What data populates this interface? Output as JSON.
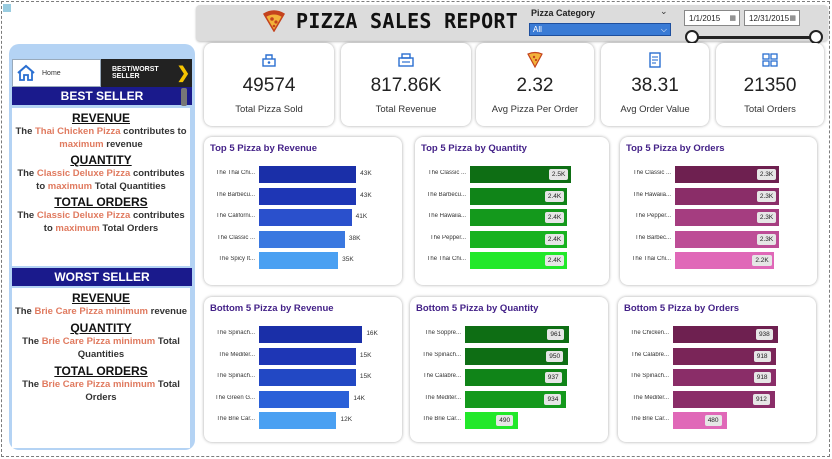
{
  "header": {
    "title": "PIZZA SALES REPORT",
    "slicer_label": "Pizza Category",
    "slicer_value": "All",
    "date_start": "1/1/2015",
    "date_end": "12/31/2015"
  },
  "nav": {
    "home_label": "Home",
    "best_worst_label": "BEST/WORST SELLER"
  },
  "best": {
    "heading": "BEST SELLER",
    "revenue": {
      "title": "REVENUE",
      "pre": "The ",
      "name": "Thai Chicken Pizza",
      "mid": " contributes to ",
      "max": "maximum",
      "post": " revenue"
    },
    "quantity": {
      "title": "QUANTITY",
      "pre": "The ",
      "name": "Classic Deluxe  Pizza",
      "mid": " contributes to ",
      "max": "maximum",
      "post": " Total Quantities"
    },
    "orders": {
      "title": "TOTAL ORDERS",
      "pre": "The ",
      "name": "Classic Deluxe  Pizza",
      "mid": " contributes to ",
      "max": "maximum",
      "post": " Total Orders"
    }
  },
  "worst": {
    "heading": "WORST SELLER",
    "revenue": {
      "title": "REVENUE",
      "pre": "The ",
      "name": "Brie Care Pizza minimum",
      "post": " revenue"
    },
    "quantity": {
      "title": "QUANTITY",
      "pre": "The ",
      "name": "Brie Care Pizza minimum",
      "post": " Total Quantities"
    },
    "orders": {
      "title": "TOTAL ORDERS",
      "pre": "The ",
      "name": "Brie Care  Pizza minimum",
      "post": " Total Orders"
    }
  },
  "kpis": [
    {
      "value": "49574",
      "label": "Total Pizza Sold",
      "icon": "takeaway-icon"
    },
    {
      "value": "817.86K",
      "label": "Total Revenue",
      "icon": "cash-register-icon"
    },
    {
      "value": "2.32",
      "label": "Avg Pizza Per Order",
      "icon": "pizza-slice-icon"
    },
    {
      "value": "38.31",
      "label": "Avg Order Value",
      "icon": "receipt-icon"
    },
    {
      "value": "21350",
      "label": "Total Orders",
      "icon": "orders-icon"
    }
  ],
  "chart_data": [
    {
      "type": "bar",
      "title": "Top 5 Pizza by Revenue",
      "categories": [
        "The Thai Chi...",
        "The Barbecu...",
        "The Californi...",
        "The Classic ...",
        "The Spicy It..."
      ],
      "values": [
        43,
        43,
        41,
        38,
        35
      ],
      "labels": [
        "43K",
        "43K",
        "41K",
        "38K",
        "35K"
      ],
      "xlim": [
        0,
        50
      ],
      "colors": [
        "#1a2fa8",
        "#1e36b5",
        "#2a50cc",
        "#3a78e0",
        "#4aa0f2"
      ],
      "label_style": "outside"
    },
    {
      "type": "bar",
      "title": "Top 5 Pizza by Quantity",
      "categories": [
        "The Classic ...",
        "The Barbecu...",
        "The Hawaiia...",
        "The Pepper...",
        "The Thai Chi..."
      ],
      "values": [
        2.5,
        2.4,
        2.4,
        2.4,
        2.4
      ],
      "labels": [
        "2.5K",
        "2.4K",
        "2.4K",
        "2.4K",
        "2.4K"
      ],
      "xlim": [
        0,
        2.7
      ],
      "colors": [
        "#0e6e14",
        "#108418",
        "#14991c",
        "#18b220",
        "#22e82a"
      ],
      "label_style": "inside"
    },
    {
      "type": "bar",
      "title": "Top 5 Pizza by Orders",
      "categories": [
        "The Classic ...",
        "The Hawaiia...",
        "The Pepper...",
        "The Barbec...",
        "The Thai Chi..."
      ],
      "values": [
        2.3,
        2.3,
        2.3,
        2.3,
        2.2
      ],
      "labels": [
        "2.3K",
        "2.3K",
        "2.3K",
        "2.3K",
        "2.2K"
      ],
      "xlim": [
        0,
        2.48
      ],
      "colors": [
        "#6e2050",
        "#8a2d68",
        "#a53d80",
        "#bd4d96",
        "#e068b8"
      ],
      "label_style": "inside"
    },
    {
      "type": "bar",
      "title": "Bottom 5 Pizza by Revenue",
      "categories": [
        "The Spinach...",
        "The Mediter...",
        "The Spinach...",
        "The Green G...",
        "The Brie Car..."
      ],
      "values": [
        16,
        15,
        15,
        14,
        12
      ],
      "labels": [
        "16K",
        "15K",
        "15K",
        "14K",
        "12K"
      ],
      "xlim": [
        0,
        17.5
      ],
      "colors": [
        "#1a2fa8",
        "#1e36b5",
        "#2248c4",
        "#2a60d8",
        "#4aa0f2"
      ],
      "label_style": "outside"
    },
    {
      "type": "bar",
      "title": "Bottom 5 Pizza by Quantity",
      "categories": [
        "The Soppre...",
        "The Spinach...",
        "The Calabre...",
        "The Mediter...",
        "The Brie Car..."
      ],
      "values": [
        961,
        950,
        937,
        934,
        490
      ],
      "labels": [
        "961",
        "950",
        "937",
        "934",
        "490"
      ],
      "xlim": [
        0,
        1040
      ],
      "colors": [
        "#0e6e14",
        "#0e6e14",
        "#108418",
        "#14991c",
        "#22e82a"
      ],
      "label_style": "inside"
    },
    {
      "type": "bar",
      "title": "Bottom 5 Pizza by Orders",
      "categories": [
        "The Chicken...",
        "The Calabre...",
        "The Spinach...",
        "The Mediter...",
        "The Brie Car..."
      ],
      "values": [
        938,
        918,
        918,
        912,
        480
      ],
      "labels": [
        "938",
        "918",
        "918",
        "912",
        "480"
      ],
      "xlim": [
        0,
        1010
      ],
      "colors": [
        "#6e2050",
        "#7a2558",
        "#8a2d68",
        "#8a2d68",
        "#e068b8"
      ],
      "label_style": "inside"
    }
  ]
}
